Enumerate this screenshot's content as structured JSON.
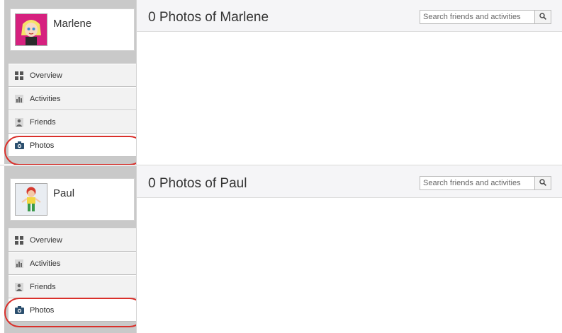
{
  "panels": [
    {
      "profile_name": "Marlene",
      "page_title": "0 Photos of Marlene",
      "search_placeholder": "Search friends and activities",
      "nav": [
        {
          "label": "Overview",
          "icon": "grid-icon"
        },
        {
          "label": "Activities",
          "icon": "bar-chart-icon"
        },
        {
          "label": "Friends",
          "icon": "person-icon"
        },
        {
          "label": "Photos",
          "icon": "camera-icon",
          "active": true
        }
      ]
    },
    {
      "profile_name": "Paul",
      "page_title": "0 Photos of Paul",
      "search_placeholder": "Search friends and activities",
      "nav": [
        {
          "label": "Overview",
          "icon": "grid-icon"
        },
        {
          "label": "Activities",
          "icon": "bar-chart-icon"
        },
        {
          "label": "Friends",
          "icon": "person-icon"
        },
        {
          "label": "Photos",
          "icon": "camera-icon",
          "active": true
        }
      ]
    }
  ],
  "colors": {
    "highlight_ring": "#d9302b",
    "sidebar_bg": "#c9c9c9",
    "header_bg": "#f5f5f7"
  }
}
